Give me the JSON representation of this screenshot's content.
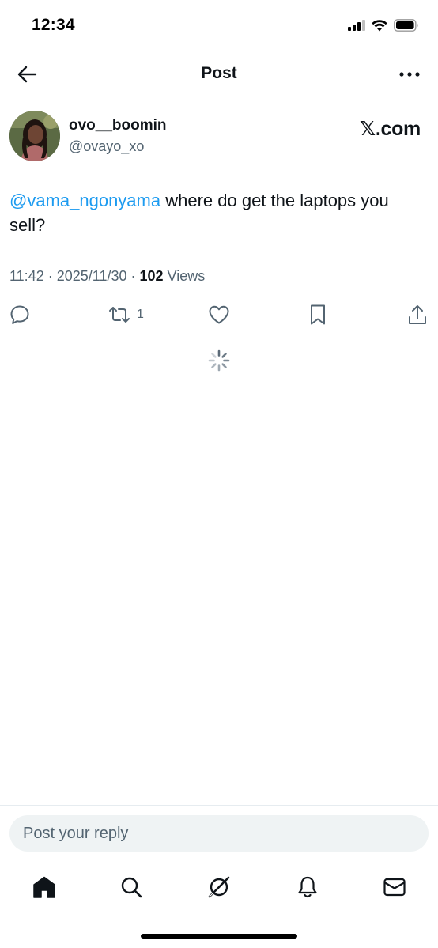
{
  "status_bar": {
    "time": "12:34"
  },
  "nav": {
    "title": "Post"
  },
  "post": {
    "display_name": "ovo__boomin",
    "handle": "@ovayo_xo",
    "source_label": "𝕏.com",
    "mention": "@vama_ngonyama",
    "text": " where do get the laptops you sell?",
    "time": "11:42",
    "date": "2025/11/30",
    "views_count": "102",
    "views_label": "Views",
    "separator": " · "
  },
  "actions": {
    "reposts_count": "1"
  },
  "reply": {
    "placeholder": "Post your reply"
  },
  "icons": {
    "back": "arrow-left-icon",
    "more": "more-horizontal-icon",
    "reply": "reply-icon",
    "repost": "repost-icon",
    "like": "heart-icon",
    "bookmark": "bookmark-icon",
    "share": "share-icon",
    "home": "home-icon",
    "search": "search-icon",
    "grok": "grok-icon",
    "notifications": "bell-icon",
    "messages": "mail-icon"
  },
  "colors": {
    "accent": "#1d9bf0",
    "text_primary": "#0f1419",
    "text_secondary": "#536471",
    "input_bg": "#eff3f4"
  }
}
